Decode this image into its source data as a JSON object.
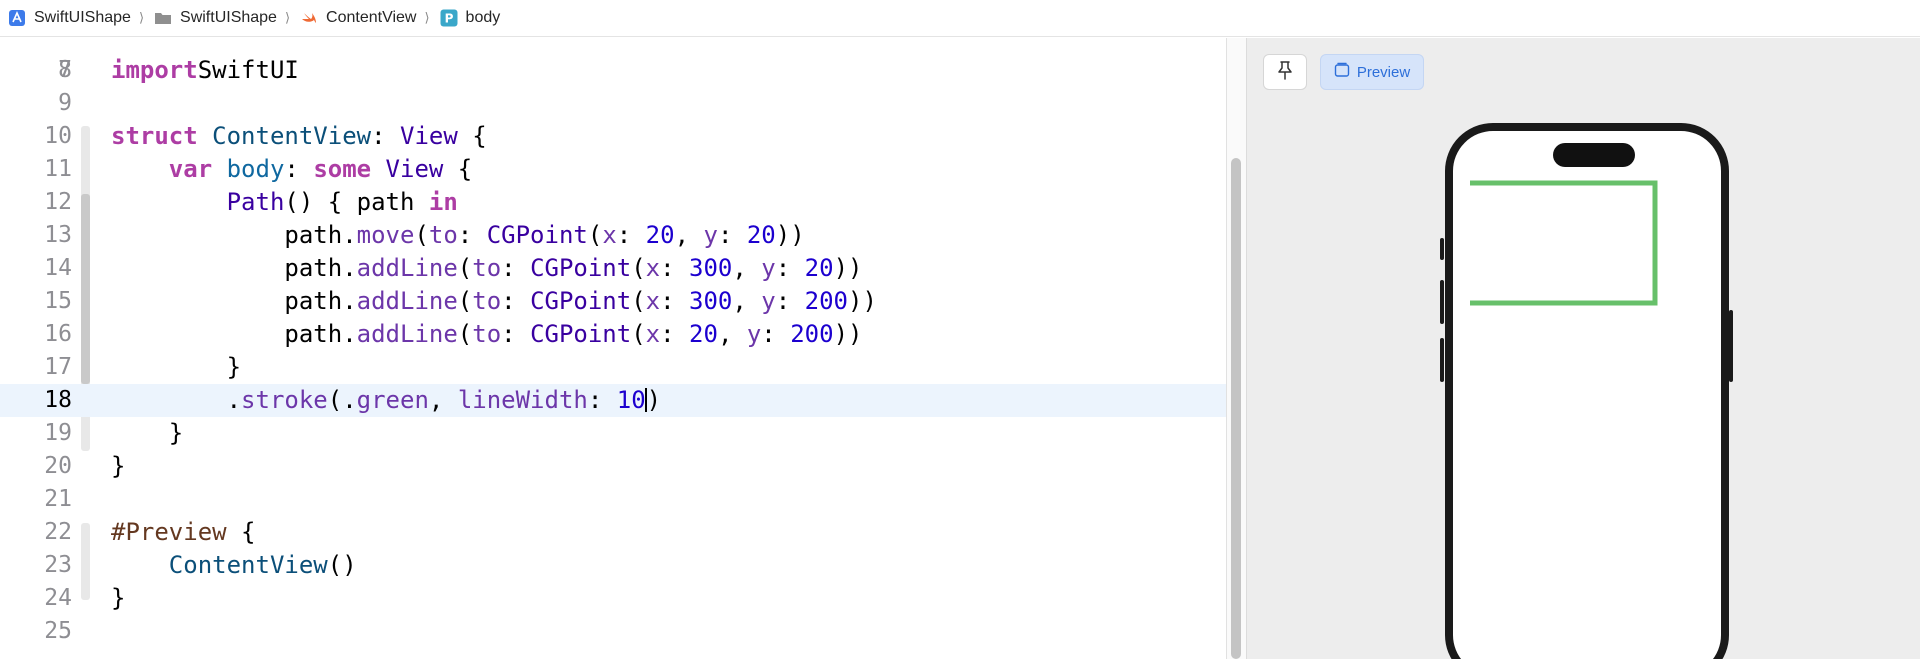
{
  "breadcrumb": [
    {
      "label": "SwiftUIShape",
      "icon": "app-project-icon"
    },
    {
      "label": "SwiftUIShape",
      "icon": "folder-icon"
    },
    {
      "label": "ContentView",
      "icon": "swift-file-icon"
    },
    {
      "label": "body",
      "icon": "property-icon",
      "icon_letter": "P"
    }
  ],
  "editor": {
    "first_line_number": "7",
    "active_line": "18",
    "lines": [
      {
        "n": "8",
        "t": [
          [
            "kw",
            "import"
          ],
          [
            "",
            "SwiftUI"
          ]
        ]
      },
      {
        "n": "9",
        "t": []
      },
      {
        "n": "10",
        "t": [
          [
            "kw",
            "struct"
          ],
          [
            "ty",
            " ContentView"
          ],
          [
            "",
            ": "
          ],
          [
            "ty2",
            "View"
          ],
          [
            "",
            " {"
          ]
        ]
      },
      {
        "n": "11",
        "t": [
          [
            "",
            "    "
          ],
          [
            "kw",
            "var"
          ],
          [
            "id",
            " body"
          ],
          [
            "",
            ": "
          ],
          [
            "kw",
            "some"
          ],
          [
            "ty2",
            " View"
          ],
          [
            "",
            " {"
          ]
        ]
      },
      {
        "n": "12",
        "t": [
          [
            "",
            "        "
          ],
          [
            "ty2",
            "Path"
          ],
          [
            "",
            "() { path "
          ],
          [
            "kw",
            "in"
          ]
        ]
      },
      {
        "n": "13",
        "t": [
          [
            "",
            "            path."
          ],
          [
            "fn",
            "move"
          ],
          [
            "",
            "("
          ],
          [
            "fn",
            "to"
          ],
          [
            "",
            ": "
          ],
          [
            "ty2",
            "CGPoint"
          ],
          [
            "",
            "("
          ],
          [
            "fn",
            "x"
          ],
          [
            "",
            ": "
          ],
          [
            "num",
            "20"
          ],
          [
            "",
            ", "
          ],
          [
            "fn",
            "y"
          ],
          [
            "",
            ": "
          ],
          [
            "num",
            "20"
          ],
          [
            "",
            "))"
          ]
        ]
      },
      {
        "n": "14",
        "t": [
          [
            "",
            "            path."
          ],
          [
            "fn",
            "addLine"
          ],
          [
            "",
            "("
          ],
          [
            "fn",
            "to"
          ],
          [
            "",
            ": "
          ],
          [
            "ty2",
            "CGPoint"
          ],
          [
            "",
            "("
          ],
          [
            "fn",
            "x"
          ],
          [
            "",
            ": "
          ],
          [
            "num",
            "300"
          ],
          [
            "",
            ", "
          ],
          [
            "fn",
            "y"
          ],
          [
            "",
            ": "
          ],
          [
            "num",
            "20"
          ],
          [
            "",
            "))"
          ]
        ]
      },
      {
        "n": "15",
        "t": [
          [
            "",
            "            path."
          ],
          [
            "fn",
            "addLine"
          ],
          [
            "",
            "("
          ],
          [
            "fn",
            "to"
          ],
          [
            "",
            ": "
          ],
          [
            "ty2",
            "CGPoint"
          ],
          [
            "",
            "("
          ],
          [
            "fn",
            "x"
          ],
          [
            "",
            ": "
          ],
          [
            "num",
            "300"
          ],
          [
            "",
            ", "
          ],
          [
            "fn",
            "y"
          ],
          [
            "",
            ": "
          ],
          [
            "num",
            "200"
          ],
          [
            "",
            "))"
          ]
        ]
      },
      {
        "n": "16",
        "t": [
          [
            "",
            "            path."
          ],
          [
            "fn",
            "addLine"
          ],
          [
            "",
            "("
          ],
          [
            "fn",
            "to"
          ],
          [
            "",
            ": "
          ],
          [
            "ty2",
            "CGPoint"
          ],
          [
            "",
            "("
          ],
          [
            "fn",
            "x"
          ],
          [
            "",
            ": "
          ],
          [
            "num",
            "20"
          ],
          [
            "",
            ", "
          ],
          [
            "fn",
            "y"
          ],
          [
            "",
            ": "
          ],
          [
            "num",
            "200"
          ],
          [
            "",
            "))"
          ]
        ]
      },
      {
        "n": "17",
        "t": [
          [
            "",
            "        }"
          ]
        ]
      },
      {
        "n": "18",
        "t": [
          [
            "",
            "        ."
          ],
          [
            "fn",
            "stroke"
          ],
          [
            "",
            "(."
          ],
          [
            "fn",
            "green"
          ],
          [
            "",
            ", "
          ],
          [
            "fn",
            "lineWidth"
          ],
          [
            "",
            ": "
          ],
          [
            "num",
            "10"
          ],
          [
            "caret",
            ""
          ],
          [
            "",
            ")"
          ]
        ]
      },
      {
        "n": "19",
        "t": [
          [
            "",
            "    }"
          ]
        ]
      },
      {
        "n": "20",
        "t": [
          [
            "",
            "}"
          ]
        ]
      },
      {
        "n": "21",
        "t": []
      },
      {
        "n": "22",
        "t": [
          [
            "macro",
            "#Preview"
          ],
          [
            "",
            " {"
          ]
        ]
      },
      {
        "n": "23",
        "t": [
          [
            "",
            "    "
          ],
          [
            "ty",
            "ContentView"
          ],
          [
            "",
            "()"
          ]
        ]
      },
      {
        "n": "24",
        "t": [
          [
            "",
            "}"
          ]
        ]
      },
      {
        "n": "25",
        "t": []
      }
    ]
  },
  "preview": {
    "pin_icon": "pin-icon",
    "mode_label": "Preview",
    "mode_icon": "preview-window-icon",
    "accent": "#2d6fd9",
    "stroke_color": "#67c06a"
  }
}
